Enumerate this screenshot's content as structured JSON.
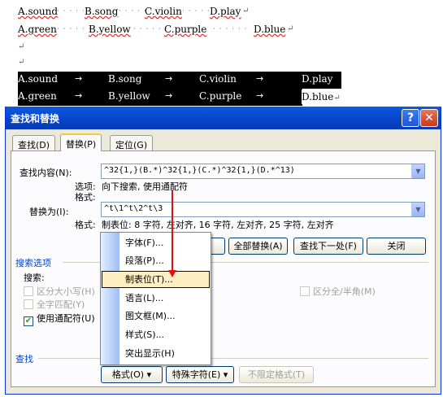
{
  "document": {
    "row1": [
      "A.sound",
      "B.song",
      "C.violin",
      "D.play"
    ],
    "row2": [
      "A.green",
      "B.yellow",
      "C.purple",
      "D.blue"
    ],
    "hl_row1": [
      "A.sound",
      "B.song",
      "C.violin",
      "D.play"
    ],
    "hl_row2": [
      "A.green",
      "B.yellow",
      "C.purple",
      "D.blue"
    ],
    "dots": "· · · · · ·",
    "para_mark": "↵",
    "tab_arrow": "→"
  },
  "dialog": {
    "title": "查找和替换",
    "help": "?",
    "close": "✕",
    "tabs": [
      "查找(D)",
      "替换(P)",
      "定位(G)"
    ],
    "find_label": "查找内容(N):",
    "find_value": "^32{1,}(B.*)^32{1,}(C.*)^32{1,}(D.*^13)",
    "options_label": "选项:",
    "options_value": "向下搜索, 使用通配符",
    "format_label": "格式:",
    "replace_label": "替换为(I):",
    "replace_value": "^t\\1^t\\2^t\\3",
    "replace_format_label": "格式:",
    "replace_format_value": "制表位:  8 字符, 左对齐,  16 字符, 左对齐,  25 字符, 左对齐",
    "buttons": {
      "replace_all": "全部替换(A)",
      "find_next": "查找下一处(F)",
      "close": "关闭"
    },
    "search_options": "搜索选项",
    "search_label": "搜索:",
    "checkboxes": {
      "match_case": "区分大小写(H)",
      "whole_word": "全字匹配(Y)",
      "wildcards": "使用通配符(U)",
      "full_half": "区分全/半角(M)"
    },
    "find_section": "查找",
    "bottom_buttons": {
      "format": "格式(O) ▾",
      "special": "特殊字符(E) ▾",
      "no_format": "不限定格式(T)"
    }
  },
  "menu": {
    "items": [
      "字体(F)...",
      "段落(P)...",
      "制表位(T)...",
      "语言(L)...",
      "图文框(M)...",
      "样式(S)...",
      "突出显示(H)"
    ],
    "selected": "制表位(T)..."
  }
}
